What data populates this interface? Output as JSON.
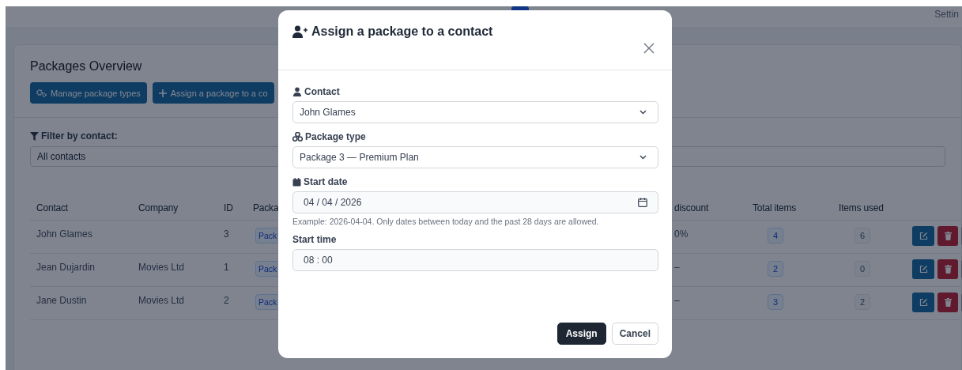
{
  "navbar": {
    "link": "Settin"
  },
  "page": {
    "title": "Packages Overview",
    "buttons": [
      {
        "kind": "manage",
        "label": "Manage package types"
      },
      {
        "kind": "assign",
        "label": "Assign a package to a co"
      }
    ],
    "filter": {
      "label": "Filter by contact:",
      "value": "All contacts"
    },
    "table": {
      "columns": [
        "Contact",
        "Company",
        "ID",
        "Packa",
        "discount",
        "Total items",
        "Items used"
      ],
      "rows": [
        {
          "contact": "John Glames",
          "company": "",
          "id": "3",
          "package": "Pack",
          "discount": "0%",
          "total_items": "4",
          "items_used": "6"
        },
        {
          "contact": "Jean Dujardin",
          "company": "Movies Ltd",
          "id": "1",
          "package": "Pack",
          "discount": "–",
          "total_items": "2",
          "items_used": "0"
        },
        {
          "contact": "Jane Dustin",
          "company": "Movies Ltd",
          "id": "2",
          "package": "Pack",
          "discount": "–",
          "total_items": "3",
          "items_used": "2"
        }
      ]
    }
  },
  "modal": {
    "title": "Assign a package to a contact",
    "fields": [
      {
        "kind": "contact",
        "label": "Contact",
        "value": "John Glames"
      },
      {
        "kind": "package",
        "label": "Package type",
        "value": "Package 3 — Premium Plan"
      },
      {
        "kind": "date",
        "label": "Start date",
        "value": "04 / 04 / 2026",
        "help": "Example: 2026-04-04. Only dates between today and the past 28 days are allowed."
      },
      {
        "kind": "time",
        "label": "Start time",
        "value": "08 : 00"
      }
    ],
    "buttons": [
      {
        "kind": "primary",
        "label": "Assign"
      },
      {
        "kind": "secondary",
        "label": "Cancel"
      }
    ]
  }
}
